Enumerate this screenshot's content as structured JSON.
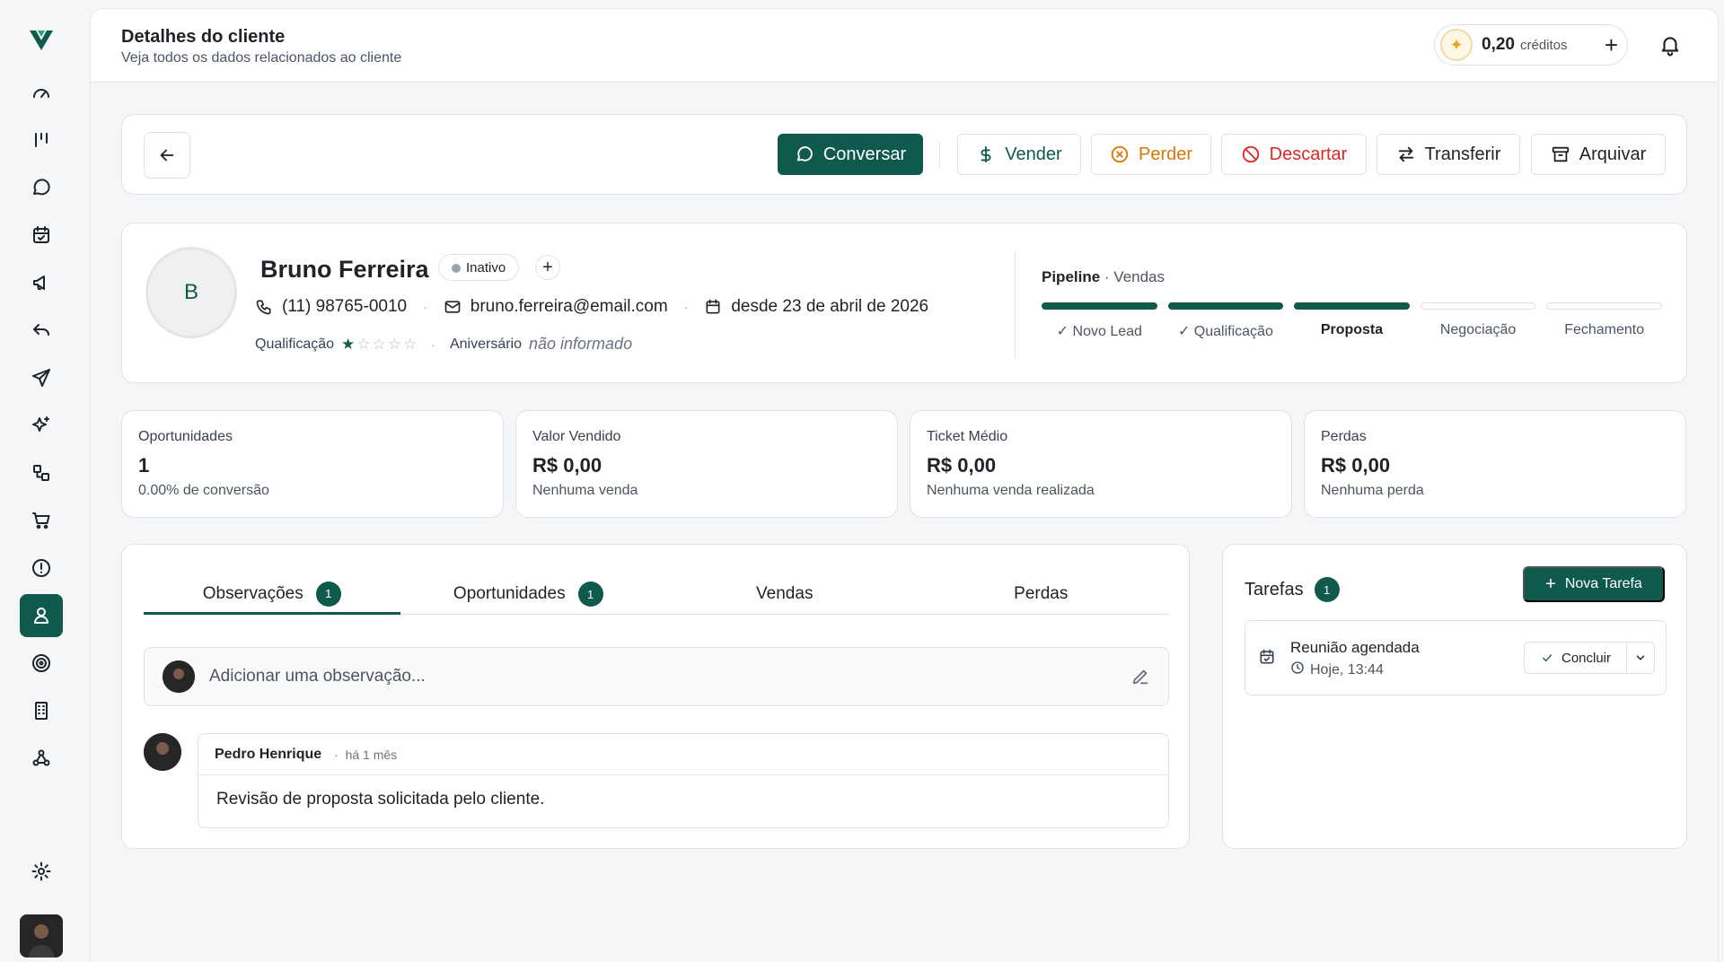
{
  "header": {
    "title": "Detalhes do cliente",
    "subtitle": "Veja todos os dados relacionados ao cliente",
    "credits_value": "0,20",
    "credits_label": "créditos",
    "credits_add": "+"
  },
  "actions": {
    "conversar": "Conversar",
    "vender": "Vender",
    "perder": "Perder",
    "descartar": "Descartar",
    "transferir": "Transferir",
    "arquivar": "Arquivar"
  },
  "client": {
    "initial": "B",
    "name": "Bruno Ferreira",
    "status": "Inativo",
    "phone": "(11) 98765-0010",
    "email": "bruno.ferreira@email.com",
    "since": "desde 23 de abril de 2026",
    "qualification_label": "Qualificação",
    "qualification_rating": 1,
    "qualification_max": 5,
    "birthday_label": "Aniversário",
    "birthday_value": "não informado"
  },
  "pipeline": {
    "label": "Pipeline",
    "name": "Vendas",
    "current_index": 2,
    "stages": [
      {
        "label": "Novo Lead",
        "done": true
      },
      {
        "label": "Qualificação",
        "done": true
      },
      {
        "label": "Proposta",
        "done": false
      },
      {
        "label": "Negociação",
        "done": false
      },
      {
        "label": "Fechamento",
        "done": false
      }
    ]
  },
  "metrics": [
    {
      "label": "Oportunidades",
      "value": "1",
      "sub": "0.00% de conversão"
    },
    {
      "label": "Valor Vendido",
      "value": "R$ 0,00",
      "sub": "Nenhuma venda"
    },
    {
      "label": "Ticket Médio",
      "value": "R$ 0,00",
      "sub": "Nenhuma venda realizada"
    },
    {
      "label": "Perdas",
      "value": "R$ 0,00",
      "sub": "Nenhuma perda"
    }
  ],
  "tabs": [
    {
      "label": "Observações",
      "count": "1"
    },
    {
      "label": "Oportunidades",
      "count": "1"
    },
    {
      "label": "Vendas",
      "count": ""
    },
    {
      "label": "Perdas",
      "count": ""
    }
  ],
  "observation": {
    "placeholder": "Adicionar uma observação..."
  },
  "comment": {
    "author": "Pedro Henrique",
    "time": "há 1 mês",
    "text": "Revisão de proposta solicitada pelo cliente."
  },
  "tasks": {
    "title": "Tarefas",
    "count": "1",
    "new_label": "Nova Tarefa",
    "items": [
      {
        "title": "Reunião agendada",
        "time": "Hoje, 13:44",
        "action": "Concluir"
      }
    ]
  },
  "colors": {
    "accent": "#0f5a4c",
    "perder": "#d97706",
    "descartar": "#dc2626"
  }
}
